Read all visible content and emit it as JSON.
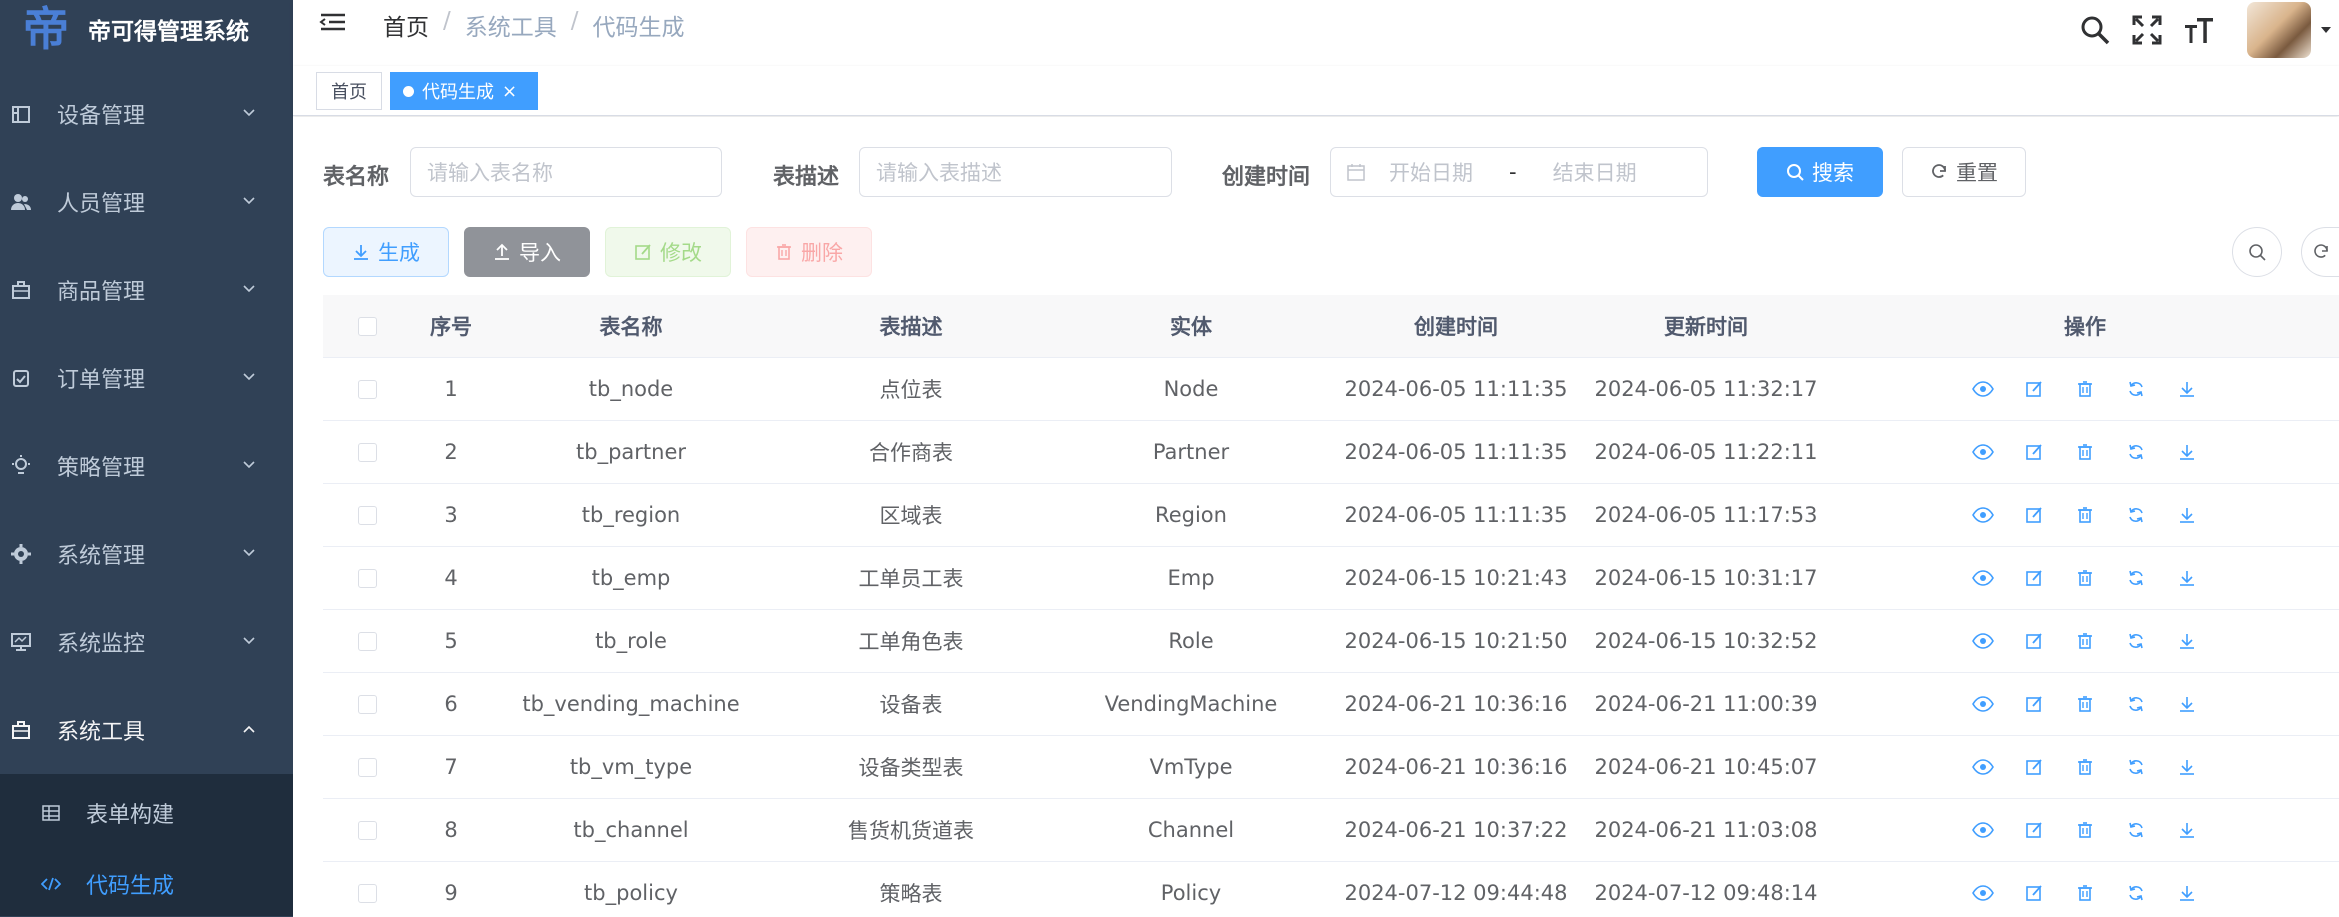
{
  "app": {
    "title": "帝可得管理系统",
    "logo_glyph": "帝"
  },
  "sidebar": {
    "items": [
      {
        "label": "设备管理",
        "icon": "device-icon"
      },
      {
        "label": "人员管理",
        "icon": "people-icon"
      },
      {
        "label": "商品管理",
        "icon": "goods-icon"
      },
      {
        "label": "订单管理",
        "icon": "order-icon"
      },
      {
        "label": "策略管理",
        "icon": "bulb-icon"
      },
      {
        "label": "系统管理",
        "icon": "gear-icon"
      },
      {
        "label": "系统监控",
        "icon": "monitor-icon"
      },
      {
        "label": "系统工具",
        "icon": "toolbox-icon"
      }
    ],
    "subitems": [
      {
        "label": "表单构建",
        "icon": "form-icon"
      },
      {
        "label": "代码生成",
        "icon": "code-icon"
      }
    ]
  },
  "navbar": {
    "breadcrumb": [
      "首页",
      "系统工具",
      "代码生成"
    ],
    "separator": "/"
  },
  "tags": {
    "home": "首页",
    "active": "代码生成",
    "close": "×"
  },
  "search": {
    "table_name_label": "表名称",
    "table_name_placeholder": "请输入表名称",
    "table_desc_label": "表描述",
    "table_desc_placeholder": "请输入表描述",
    "create_time_label": "创建时间",
    "start_placeholder": "开始日期",
    "range_sep": "-",
    "end_placeholder": "结束日期",
    "search_btn": "搜索",
    "reset_btn": "重置"
  },
  "toolbar": {
    "generate": "生成",
    "import": "导入",
    "edit": "修改",
    "delete": "删除"
  },
  "table": {
    "columns": [
      "序号",
      "表名称",
      "表描述",
      "实体",
      "创建时间",
      "更新时间",
      "操作"
    ],
    "rows": [
      {
        "no": "1",
        "name": "tb_node",
        "desc": "点位表",
        "entity": "Node",
        "created": "2024-06-05 11:11:35",
        "updated": "2024-06-05 11:32:17"
      },
      {
        "no": "2",
        "name": "tb_partner",
        "desc": "合作商表",
        "entity": "Partner",
        "created": "2024-06-05 11:11:35",
        "updated": "2024-06-05 11:22:11"
      },
      {
        "no": "3",
        "name": "tb_region",
        "desc": "区域表",
        "entity": "Region",
        "created": "2024-06-05 11:11:35",
        "updated": "2024-06-05 11:17:53"
      },
      {
        "no": "4",
        "name": "tb_emp",
        "desc": "工单员工表",
        "entity": "Emp",
        "created": "2024-06-15 10:21:43",
        "updated": "2024-06-15 10:31:17"
      },
      {
        "no": "5",
        "name": "tb_role",
        "desc": "工单角色表",
        "entity": "Role",
        "created": "2024-06-15 10:21:50",
        "updated": "2024-06-15 10:32:52"
      },
      {
        "no": "6",
        "name": "tb_vending_machine",
        "desc": "设备表",
        "entity": "VendingMachine",
        "created": "2024-06-21 10:36:16",
        "updated": "2024-06-21 11:00:39"
      },
      {
        "no": "7",
        "name": "tb_vm_type",
        "desc": "设备类型表",
        "entity": "VmType",
        "created": "2024-06-21 10:36:16",
        "updated": "2024-06-21 10:45:07"
      },
      {
        "no": "8",
        "name": "tb_channel",
        "desc": "售货机货道表",
        "entity": "Channel",
        "created": "2024-06-21 10:37:22",
        "updated": "2024-06-21 11:03:08"
      },
      {
        "no": "9",
        "name": "tb_policy",
        "desc": "策略表",
        "entity": "Policy",
        "created": "2024-07-12 09:44:48",
        "updated": "2024-07-12 09:48:14"
      }
    ]
  },
  "colors": {
    "sidebar_bg": "#304156",
    "submenu_bg": "#1f2d3d",
    "primary": "#409eff",
    "info": "#909399"
  }
}
